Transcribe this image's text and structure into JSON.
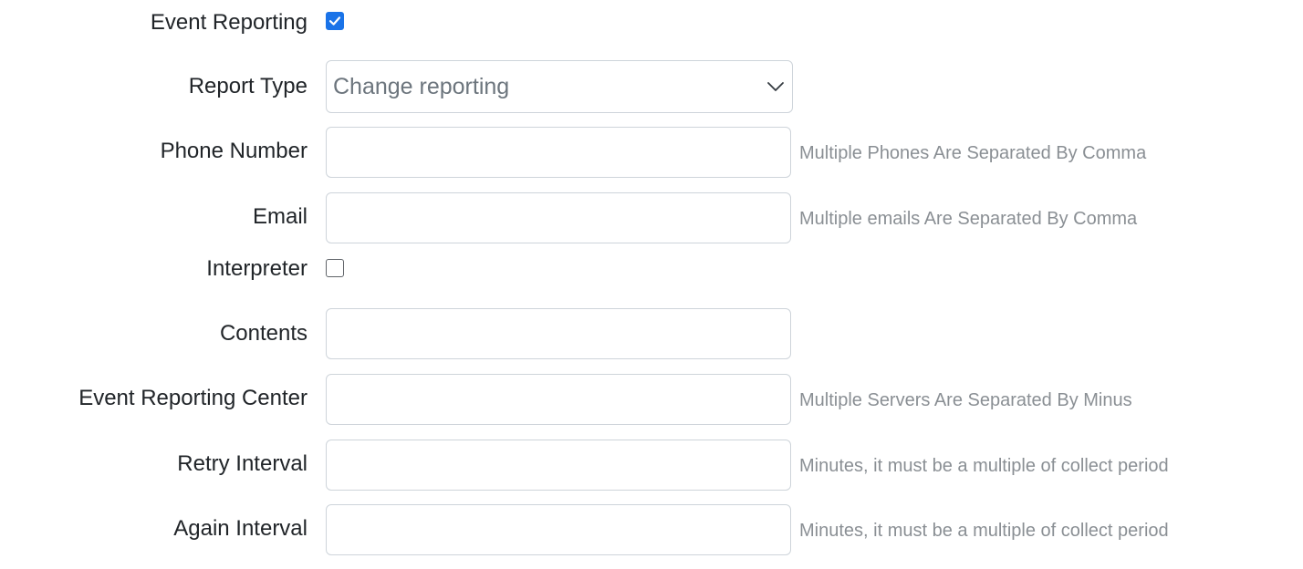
{
  "form": {
    "event_reporting": {
      "label": "Event Reporting",
      "checked": true
    },
    "report_type": {
      "label": "Report Type",
      "selected": "Change reporting"
    },
    "phone_number": {
      "label": "Phone Number",
      "value": "",
      "hint": "Multiple Phones Are Separated By Comma"
    },
    "email": {
      "label": "Email",
      "value": "",
      "hint": "Multiple emails Are Separated By Comma"
    },
    "interpreter": {
      "label": "Interpreter",
      "checked": false
    },
    "contents": {
      "label": "Contents",
      "value": ""
    },
    "event_reporting_center": {
      "label": "Event Reporting Center",
      "value": "",
      "hint": "Multiple Servers Are Separated By Minus"
    },
    "retry_interval": {
      "label": "Retry Interval",
      "value": "",
      "hint": "Minutes, it must be a multiple of collect period"
    },
    "again_interval": {
      "label": "Again Interval",
      "value": "",
      "hint": "Minutes, it must be a multiple of collect period"
    }
  },
  "colors": {
    "checkbox_checked": "#1a73e8",
    "hint_text": "#8a8f94",
    "input_border": "#ced4da"
  },
  "icons": {
    "checkmark": "check-icon",
    "dropdown": "chevron-down-icon"
  }
}
